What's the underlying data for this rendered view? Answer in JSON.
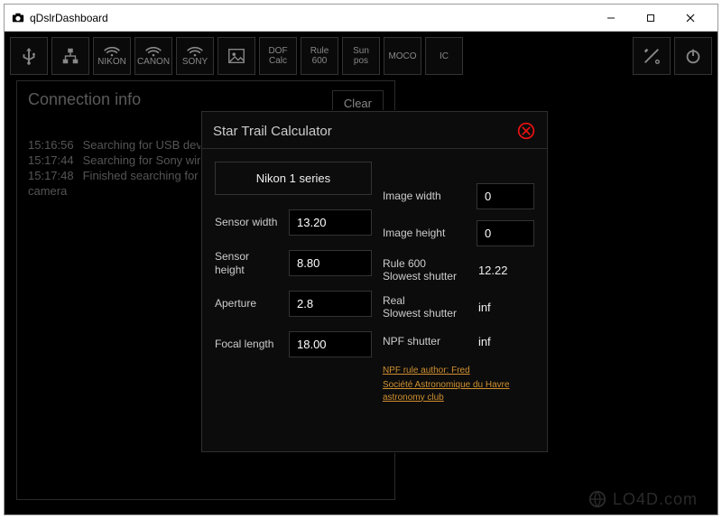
{
  "window": {
    "title": "qDslrDashboard"
  },
  "toolbar": {
    "nikon": "NIKON",
    "canon": "CANON",
    "sony": "SONY",
    "dof": "DOF\nCalc",
    "rule600": "Rule\n600",
    "sunpos": "Sun\npos",
    "moco": "MOCO",
    "ic": "IC"
  },
  "connection": {
    "title": "Connection info",
    "clear": "Clear",
    "log": [
      {
        "time": "15:16:56",
        "msg": "Searching for USB devices"
      },
      {
        "time": "15:17:44",
        "msg": "Searching for Sony wireless camera"
      },
      {
        "time": "15:17:48",
        "msg": "Finished searching for Sony wireless"
      }
    ],
    "log_tail_prefix": "camera"
  },
  "dialog": {
    "title": "Star Trail Calculator",
    "series_label": "Nikon 1 series",
    "sensor_width_label": "Sensor width",
    "sensor_width_value": "13.20",
    "sensor_height_label": "Sensor height",
    "sensor_height_value": "8.80",
    "aperture_label": "Aperture",
    "aperture_value": "2.8",
    "focal_length_label": "Focal length",
    "focal_length_value": "18.00",
    "image_width_label": "Image width",
    "image_width_value": "0",
    "image_height_label": "Image height",
    "image_height_value": "0",
    "rule600_label": "Rule 600\nSlowest shutter",
    "rule600_value": "12.22",
    "real_label": "Real\nSlowest shutter",
    "real_value": "inf",
    "npf_label": "NPF shutter",
    "npf_value": "inf",
    "credit1": "NPF rule author: Fred",
    "credit2": "Société Astronomique du Havre astronomy club"
  },
  "watermark": "LO4D.com",
  "icons": {
    "usb": "usb-icon",
    "network": "network-icon",
    "wifi": "wifi-icon",
    "image": "image-icon",
    "tools": "tools-icon",
    "power": "power-icon",
    "minimize": "minimize-icon",
    "maximize": "maximize-icon",
    "close": "close-icon"
  }
}
